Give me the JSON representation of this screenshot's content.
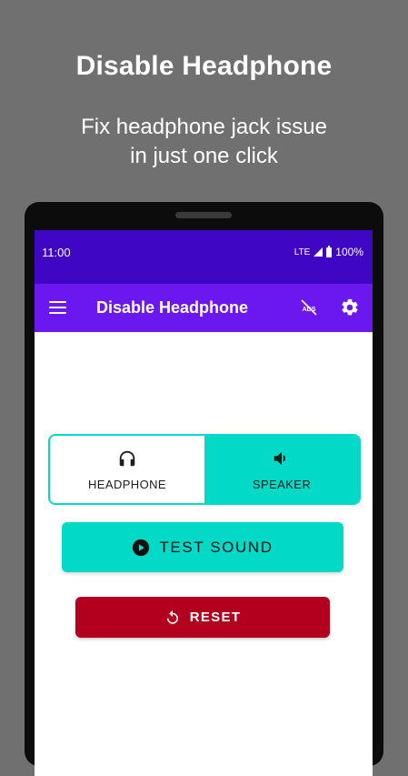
{
  "promo": {
    "title": "Disable Headphone",
    "subtitle_line1": "Fix headphone jack issue",
    "subtitle_line2": "in just one click"
  },
  "status_bar": {
    "time": "11:00",
    "network": "LTE",
    "battery": "100%"
  },
  "app_bar": {
    "title": "Disable Headphone",
    "icons": [
      "menu-icon",
      "no-ads-icon",
      "gear-icon"
    ]
  },
  "audio_toggle": {
    "options": [
      {
        "label": "HEADPHONE",
        "icon": "headphones-icon"
      },
      {
        "label": "SPEAKER",
        "icon": "speaker-icon"
      }
    ]
  },
  "test_button": {
    "label": "TEST SOUND",
    "icon": "play-circle-icon"
  },
  "reset_button": {
    "label": "RESET",
    "icon": "reset-icon"
  },
  "colors": {
    "status_bar": "#3f06c4",
    "app_bar": "#6a17f0",
    "accent": "#02d9c6",
    "reset": "#b4001f",
    "background": "#707070"
  }
}
